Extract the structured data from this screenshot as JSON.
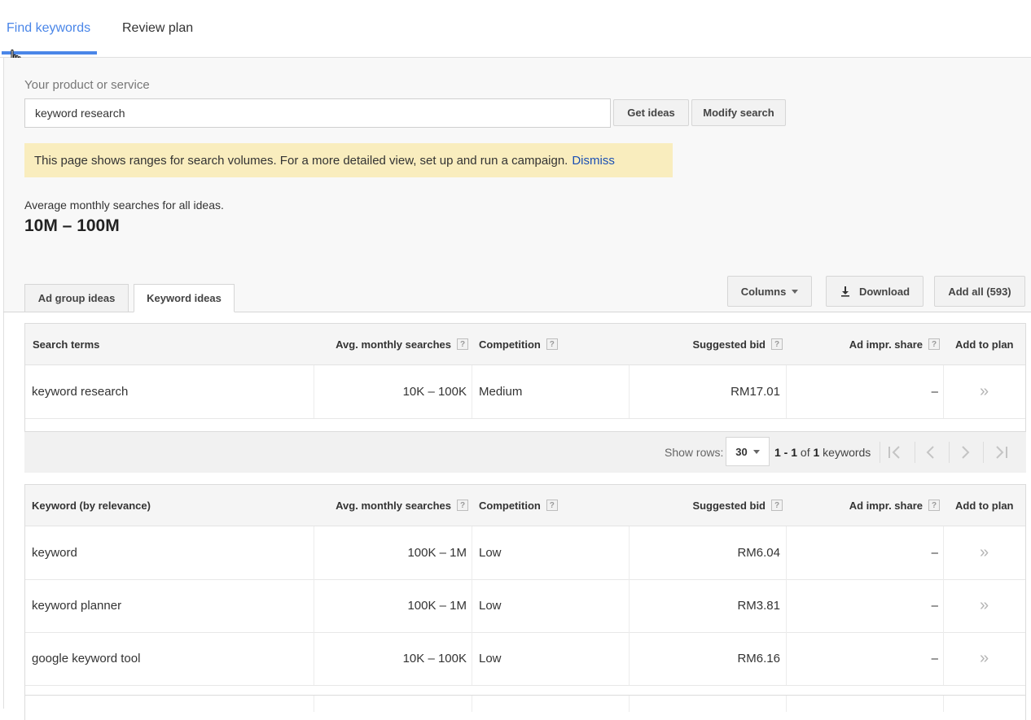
{
  "top_tabs": {
    "find": "Find keywords",
    "review": "Review plan"
  },
  "search": {
    "label": "Your product or service",
    "value": "keyword research",
    "get_ideas": "Get ideas",
    "modify": "Modify search"
  },
  "notice": {
    "text": "This page shows ranges for search volumes. For a more detailed view, set up and run a campaign.",
    "dismiss": "Dismiss"
  },
  "summary": {
    "label": "Average monthly searches for all ideas.",
    "value": "10M – 100M"
  },
  "sub_tabs": {
    "ad_group": "Ad group ideas",
    "keyword": "Keyword ideas"
  },
  "toolbar": {
    "columns": "Columns",
    "download": "Download",
    "add_all": "Add all (593)"
  },
  "headers": {
    "search_terms": "Search terms",
    "keyword_relevance": "Keyword (by relevance)",
    "avg": "Avg. monthly searches",
    "competition": "Competition",
    "bid": "Suggested bid",
    "impr": "Ad impr. share",
    "add": "Add to plan",
    "help": "?"
  },
  "search_terms_rows": [
    {
      "term": "keyword research",
      "avg": "10K – 100K",
      "competition": "Medium",
      "bid": "RM17.01",
      "impr": "–",
      "add": "»"
    }
  ],
  "pager": {
    "show_rows": "Show rows:",
    "rows_value": "30",
    "range": "1 - 1",
    "of": "of",
    "total": "1",
    "unit": "keywords"
  },
  "keyword_rows": [
    {
      "term": "keyword",
      "avg": "100K – 1M",
      "competition": "Low",
      "bid": "RM6.04",
      "impr": "–",
      "add": "»"
    },
    {
      "term": "keyword planner",
      "avg": "100K – 1M",
      "competition": "Low",
      "bid": "RM3.81",
      "impr": "–",
      "add": "»"
    },
    {
      "term": "google keyword tool",
      "avg": "10K – 100K",
      "competition": "Low",
      "bid": "RM6.16",
      "impr": "–",
      "add": "»"
    }
  ]
}
